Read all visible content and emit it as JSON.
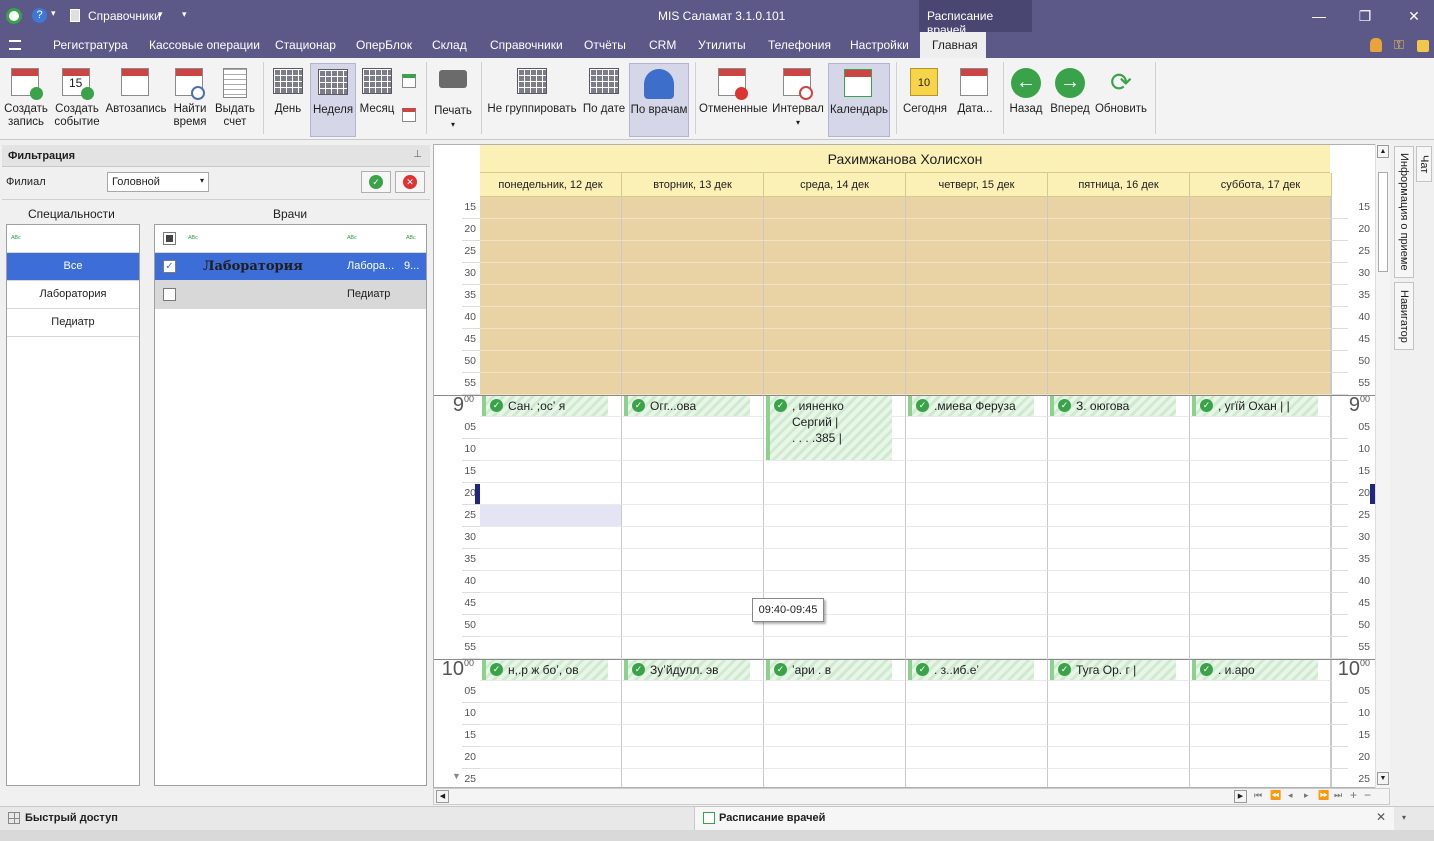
{
  "titlebar": {
    "app_title": "MIS Саламат 3.1.0.101",
    "context_tab": "Расписание врачей",
    "quick_item": "Справочники"
  },
  "menu": [
    "Регистратура",
    "Кассовые операции",
    "Стационар",
    "ОперБлок",
    "Склад",
    "Справочники",
    "Отчёты",
    "CRM",
    "Утилиты",
    "Телефония",
    "Настройки",
    "Главная"
  ],
  "ribbon": {
    "create_record": "Создать запись",
    "create_event": "Создать событие",
    "autorecord": "Автозапись",
    "find_time": "Найти время",
    "issue_bill": "Выдать счет",
    "day": "День",
    "week": "Неделя",
    "month": "Месяц",
    "print": "Печать",
    "no_group": "Не группировать",
    "by_date": "По дате",
    "by_doctors": "По врачам",
    "cancelled": "Отмененные",
    "interval": "Интервал",
    "calendar": "Календарь",
    "today": "Сегодня",
    "date": "Дата...",
    "back": "Назад",
    "forward": "Вперед",
    "refresh": "Обновить",
    "cal_day_num": "15",
    "today_num": "10"
  },
  "filter": {
    "title": "Фильтрация",
    "branch_label": "Филиал",
    "branch_value": "Головной",
    "specialties_header": "Специальности",
    "doctors_header": "Врачи",
    "specialties": [
      "Все",
      "Лаборатория",
      "Педиатр"
    ],
    "doctors": [
      {
        "name": "Лаборатория",
        "spec": "Лабора...",
        "extra": "9...",
        "checked": true
      },
      {
        "name": "",
        "spec": "Педиатр",
        "extra": "",
        "checked": false
      }
    ]
  },
  "schedule": {
    "doctor": "Рахимжанова Холисхон",
    "days": [
      "понедельник, 12 дек",
      "вторник, 13 дек",
      "среда, 14 дек",
      "четверг, 15 дек",
      "пятница, 16 дек",
      "суббота, 17 дек"
    ],
    "hour_9": "9",
    "hour_10": "10",
    "hour_sup": "00",
    "minutes_8": [
      "15",
      "20",
      "25",
      "30",
      "35",
      "40",
      "45",
      "50",
      "55"
    ],
    "minutes_9": [
      "05",
      "10",
      "15",
      "20",
      "25",
      "30",
      "35",
      "40",
      "45",
      "50",
      "55"
    ],
    "minutes_10": [
      "05",
      "10",
      "15",
      "20",
      "25"
    ],
    "appointments_9": [
      "Сан. ;осʼ я",
      "Огг...ова",
      ", ияненко",
      ".миева Феруза",
      "З. оюгова",
      ", угїй Охан  |  |"
    ],
    "appt_wed_line2": "Сергий  |",
    "appt_wed_line3": ". . . .385 |",
    "appointments_10": [
      "н,.р ж  боʼ, ов",
      "Зуʼйдулл. эв",
      "ʼари  . в",
      ". з..иб.еʼ",
      "Туга  Ор. г    |",
      ". и.аро"
    ],
    "tooltip": "09:40-09:45"
  },
  "right_tabs": [
    "Информация о приеме",
    "Навигатор",
    "Чат"
  ],
  "bottom": {
    "quick_access": "Быстрый доступ",
    "doc_tab": "Расписание врачей"
  }
}
